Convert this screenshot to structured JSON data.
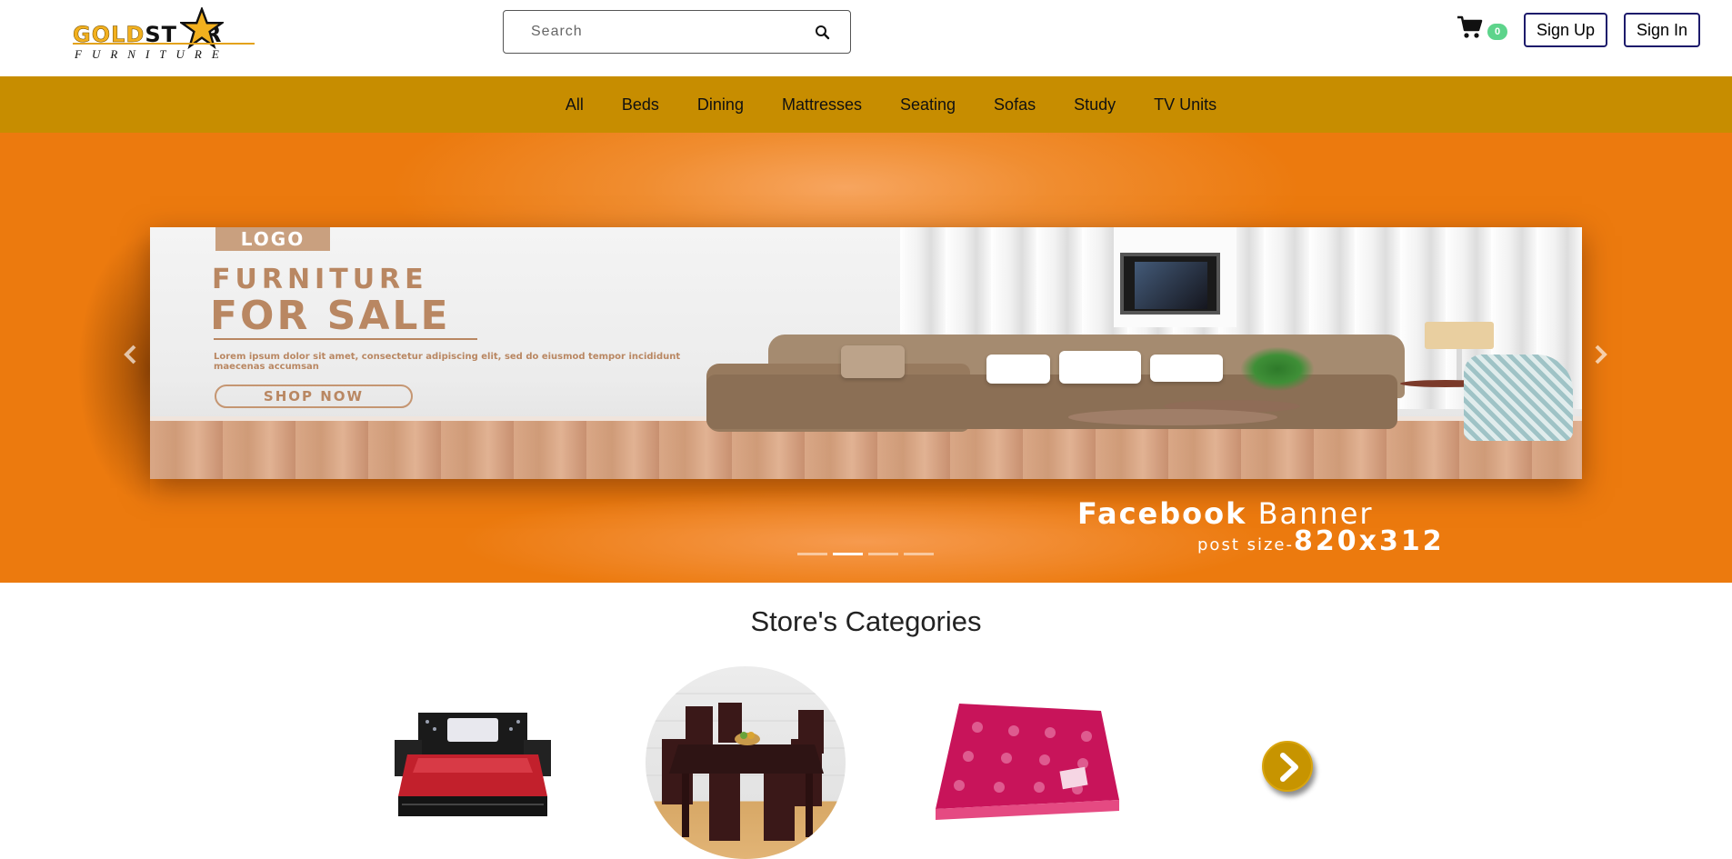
{
  "brand": {
    "name_gold": "GOLD",
    "name_star": "ST",
    "name_end": "R",
    "tagline": "FURNITURE",
    "gold_color": "#f2b01e"
  },
  "search": {
    "placeholder": "Search",
    "icon": "search-icon"
  },
  "cart": {
    "icon": "shopping-cart-icon",
    "count": "0",
    "badge_color": "#5dd48b"
  },
  "auth": {
    "signup_label": "Sign Up",
    "signin_label": "Sign In",
    "border_color": "#1d1b6b"
  },
  "nav": {
    "background": "#c78d00",
    "items": [
      "All",
      "Beds",
      "Dining",
      "Mattresses",
      "Seating",
      "Sofas",
      "Study",
      "TV Units"
    ]
  },
  "hero": {
    "background": "#ec7a0e",
    "banner": {
      "logo": "LOGO",
      "title_line1": "FURNITURE",
      "title_line2": "FOR SALE",
      "body": "Lorem ipsum dolor sit amet, consectetur adipiscing elit, sed do eiusmod tempor incididunt maecenas accumsan",
      "cta": "SHOP NOW"
    },
    "caption": {
      "bold": "Facebook",
      "light": "Banner",
      "sub_prefix": "post size-",
      "sub_size": "820x312"
    },
    "slides_count": 4,
    "active_slide": 2,
    "prev_icon": "chevron-left-icon",
    "next_icon": "chevron-right-icon"
  },
  "categories": {
    "title": "Store's Categories",
    "items": [
      {
        "name": "bed",
        "icon": "bed-image"
      },
      {
        "name": "dining",
        "icon": "dining-set-image"
      },
      {
        "name": "mattress",
        "icon": "mattress-image"
      }
    ],
    "next_icon": "chevron-right-icon",
    "accent": "#c79400"
  }
}
